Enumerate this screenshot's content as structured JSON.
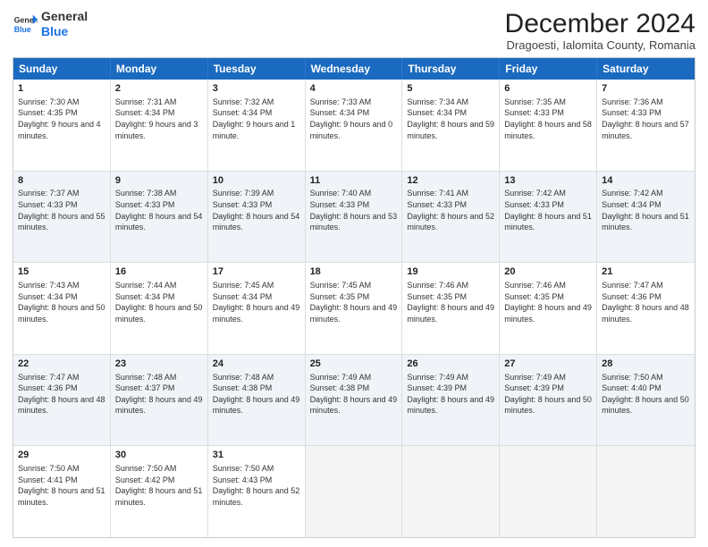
{
  "header": {
    "logo_general": "General",
    "logo_blue": "Blue",
    "month_title": "December 2024",
    "location": "Dragoesti, Ialomita County, Romania"
  },
  "weekdays": [
    "Sunday",
    "Monday",
    "Tuesday",
    "Wednesday",
    "Thursday",
    "Friday",
    "Saturday"
  ],
  "rows": [
    [
      {
        "day": "1",
        "sunrise": "7:30 AM",
        "sunset": "4:35 PM",
        "daylight": "9 hours and 4 minutes.",
        "shaded": false
      },
      {
        "day": "2",
        "sunrise": "7:31 AM",
        "sunset": "4:34 PM",
        "daylight": "9 hours and 3 minutes.",
        "shaded": false
      },
      {
        "day": "3",
        "sunrise": "7:32 AM",
        "sunset": "4:34 PM",
        "daylight": "9 hours and 1 minute.",
        "shaded": false
      },
      {
        "day": "4",
        "sunrise": "7:33 AM",
        "sunset": "4:34 PM",
        "daylight": "9 hours and 0 minutes.",
        "shaded": false
      },
      {
        "day": "5",
        "sunrise": "7:34 AM",
        "sunset": "4:34 PM",
        "daylight": "8 hours and 59 minutes.",
        "shaded": false
      },
      {
        "day": "6",
        "sunrise": "7:35 AM",
        "sunset": "4:33 PM",
        "daylight": "8 hours and 58 minutes.",
        "shaded": false
      },
      {
        "day": "7",
        "sunrise": "7:36 AM",
        "sunset": "4:33 PM",
        "daylight": "8 hours and 57 minutes.",
        "shaded": false
      }
    ],
    [
      {
        "day": "8",
        "sunrise": "7:37 AM",
        "sunset": "4:33 PM",
        "daylight": "8 hours and 55 minutes.",
        "shaded": true
      },
      {
        "day": "9",
        "sunrise": "7:38 AM",
        "sunset": "4:33 PM",
        "daylight": "8 hours and 54 minutes.",
        "shaded": true
      },
      {
        "day": "10",
        "sunrise": "7:39 AM",
        "sunset": "4:33 PM",
        "daylight": "8 hours and 54 minutes.",
        "shaded": true
      },
      {
        "day": "11",
        "sunrise": "7:40 AM",
        "sunset": "4:33 PM",
        "daylight": "8 hours and 53 minutes.",
        "shaded": true
      },
      {
        "day": "12",
        "sunrise": "7:41 AM",
        "sunset": "4:33 PM",
        "daylight": "8 hours and 52 minutes.",
        "shaded": true
      },
      {
        "day": "13",
        "sunrise": "7:42 AM",
        "sunset": "4:33 PM",
        "daylight": "8 hours and 51 minutes.",
        "shaded": true
      },
      {
        "day": "14",
        "sunrise": "7:42 AM",
        "sunset": "4:34 PM",
        "daylight": "8 hours and 51 minutes.",
        "shaded": true
      }
    ],
    [
      {
        "day": "15",
        "sunrise": "7:43 AM",
        "sunset": "4:34 PM",
        "daylight": "8 hours and 50 minutes.",
        "shaded": false
      },
      {
        "day": "16",
        "sunrise": "7:44 AM",
        "sunset": "4:34 PM",
        "daylight": "8 hours and 50 minutes.",
        "shaded": false
      },
      {
        "day": "17",
        "sunrise": "7:45 AM",
        "sunset": "4:34 PM",
        "daylight": "8 hours and 49 minutes.",
        "shaded": false
      },
      {
        "day": "18",
        "sunrise": "7:45 AM",
        "sunset": "4:35 PM",
        "daylight": "8 hours and 49 minutes.",
        "shaded": false
      },
      {
        "day": "19",
        "sunrise": "7:46 AM",
        "sunset": "4:35 PM",
        "daylight": "8 hours and 49 minutes.",
        "shaded": false
      },
      {
        "day": "20",
        "sunrise": "7:46 AM",
        "sunset": "4:35 PM",
        "daylight": "8 hours and 49 minutes.",
        "shaded": false
      },
      {
        "day": "21",
        "sunrise": "7:47 AM",
        "sunset": "4:36 PM",
        "daylight": "8 hours and 48 minutes.",
        "shaded": false
      }
    ],
    [
      {
        "day": "22",
        "sunrise": "7:47 AM",
        "sunset": "4:36 PM",
        "daylight": "8 hours and 48 minutes.",
        "shaded": true
      },
      {
        "day": "23",
        "sunrise": "7:48 AM",
        "sunset": "4:37 PM",
        "daylight": "8 hours and 49 minutes.",
        "shaded": true
      },
      {
        "day": "24",
        "sunrise": "7:48 AM",
        "sunset": "4:38 PM",
        "daylight": "8 hours and 49 minutes.",
        "shaded": true
      },
      {
        "day": "25",
        "sunrise": "7:49 AM",
        "sunset": "4:38 PM",
        "daylight": "8 hours and 49 minutes.",
        "shaded": true
      },
      {
        "day": "26",
        "sunrise": "7:49 AM",
        "sunset": "4:39 PM",
        "daylight": "8 hours and 49 minutes.",
        "shaded": true
      },
      {
        "day": "27",
        "sunrise": "7:49 AM",
        "sunset": "4:39 PM",
        "daylight": "8 hours and 50 minutes.",
        "shaded": true
      },
      {
        "day": "28",
        "sunrise": "7:50 AM",
        "sunset": "4:40 PM",
        "daylight": "8 hours and 50 minutes.",
        "shaded": true
      }
    ],
    [
      {
        "day": "29",
        "sunrise": "7:50 AM",
        "sunset": "4:41 PM",
        "daylight": "8 hours and 51 minutes.",
        "shaded": false
      },
      {
        "day": "30",
        "sunrise": "7:50 AM",
        "sunset": "4:42 PM",
        "daylight": "8 hours and 51 minutes.",
        "shaded": false
      },
      {
        "day": "31",
        "sunrise": "7:50 AM",
        "sunset": "4:43 PM",
        "daylight": "8 hours and 52 minutes.",
        "shaded": false
      },
      {
        "day": "",
        "sunrise": "",
        "sunset": "",
        "daylight": "",
        "shaded": false,
        "empty": true
      },
      {
        "day": "",
        "sunrise": "",
        "sunset": "",
        "daylight": "",
        "shaded": false,
        "empty": true
      },
      {
        "day": "",
        "sunrise": "",
        "sunset": "",
        "daylight": "",
        "shaded": false,
        "empty": true
      },
      {
        "day": "",
        "sunrise": "",
        "sunset": "",
        "daylight": "",
        "shaded": false,
        "empty": true
      }
    ]
  ]
}
